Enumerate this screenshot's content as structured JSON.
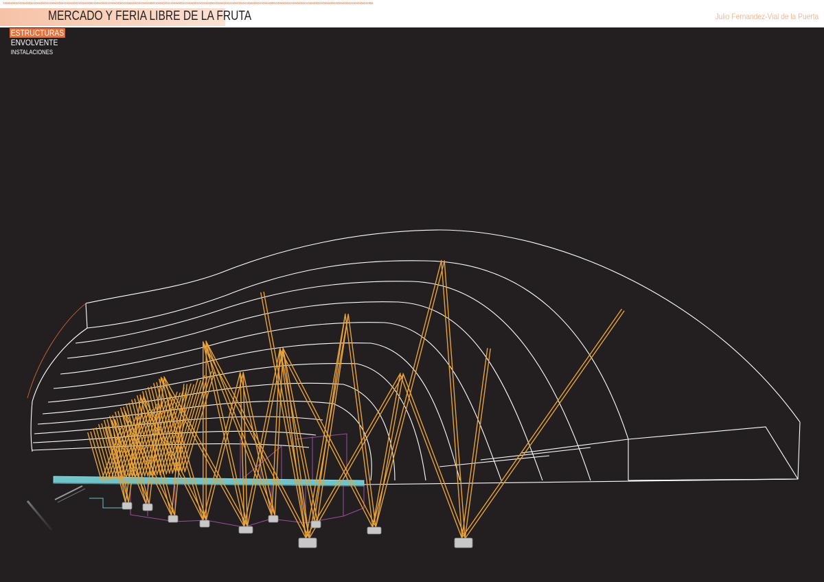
{
  "header": {
    "chevrons": "›››››››››››››››››››››››››››››››››››››››››››››››››››››››››››››››››››››››››››››››››››››››››››››››››››››››››››››››››››››››››››››››››››››››››››››››››››››››››››››››››››››››››››››››››››››››››››››››››››››››››››››››››››››››››››››››››››››››››››››››››››››",
    "title": "MERCADO Y FERIA LIBRE DE LA FRUTA",
    "author": "Julio Fernandez-Vial de la Puerta"
  },
  "menu": {
    "items": [
      {
        "label": "ESTRUCTURAS",
        "state": "active"
      },
      {
        "label": "ENVOLVENTE",
        "state": "normal"
      },
      {
        "label": "INSTALACIONES",
        "state": "small"
      }
    ]
  },
  "colors": {
    "background": "#231f20",
    "accent": "#e8703a",
    "column": "#e8a33a",
    "envelope": "#ffffff",
    "slab": "#6fc3c9",
    "enclosure": "#9b4fa0",
    "footing": "#c8c8c8"
  }
}
